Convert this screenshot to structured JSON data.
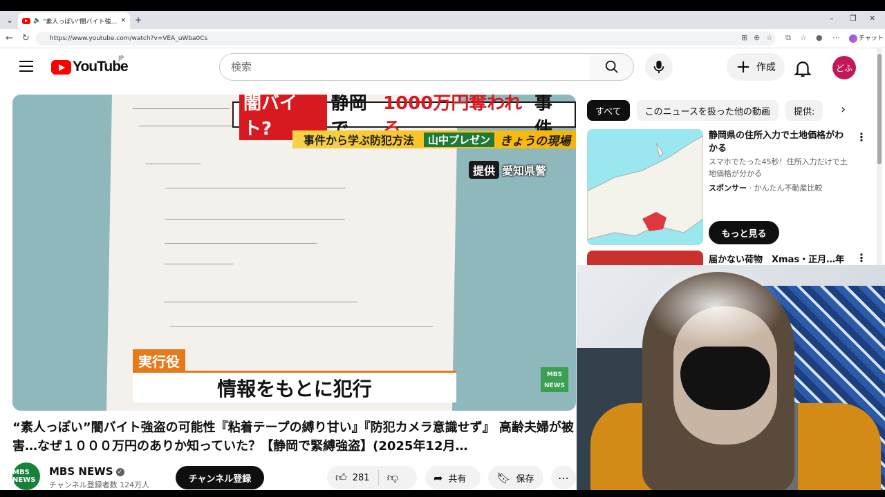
{
  "browser": {
    "tab_title": "\"素人っぽい\"闇バイト強盗の可能",
    "url": "https://www.youtube.com/watch?v=VEA_uWba0Cs",
    "chat_label": "チャット"
  },
  "header": {
    "logo_text": "YouTube",
    "country_code": "JP",
    "search_placeholder": "検索",
    "create_label": "作成",
    "avatar_text": "どふ"
  },
  "player": {
    "caption_head_tag": "闇バイト?",
    "caption_head_mid": "静岡で",
    "caption_head_big": "1000万円奪われる",
    "caption_head_end": "事件",
    "caption_sub": "事件から学ぶ防犯方法",
    "caption_tag": "山中プレゼン",
    "caption_tag2": "きょうの現場",
    "provide_label": "提供",
    "provide_source": "愛知県警",
    "lower_label": "実行役",
    "lower_text": "情報をもとに犯行",
    "watermark": "MBS NEWS"
  },
  "video": {
    "title": "“素人っぽい”闇バイト強盗の可能性『粘着テープの縛り甘い』『防犯カメラ意識せず』 高齢夫婦が被害…なぜ１０００万円のありか知っていた？【静岡で緊縛強盗】(2025年12月…",
    "channel_name": "MBS NEWS",
    "channel_avatar_text": "MBS NEWS",
    "subscribers": "チャンネル登録者数 124万人",
    "subscribe_label": "チャンネル登録",
    "likes": "281",
    "share_label": "共有",
    "save_label": "保存"
  },
  "sidebar": {
    "chips": [
      "すべて",
      "このニュースを扱った他の動画",
      "提供:"
    ],
    "ad": {
      "title": "静岡県の住所入力で土地価格がわかる",
      "description": "スマホでたった45秒！住所入力だけで土地価格が分かる",
      "sponsor_label": "スポンサー",
      "sponsor_name": "かんたん不動産比較",
      "more_label": "もっと見る"
    },
    "rec2_title": "届かない荷物　Xmas・正月…年"
  },
  "colors": {
    "brand_red": "#FF0000",
    "avatar_bg": "#C2185B",
    "caption_red": "#D71920",
    "lower_orange": "#E57A1B"
  }
}
